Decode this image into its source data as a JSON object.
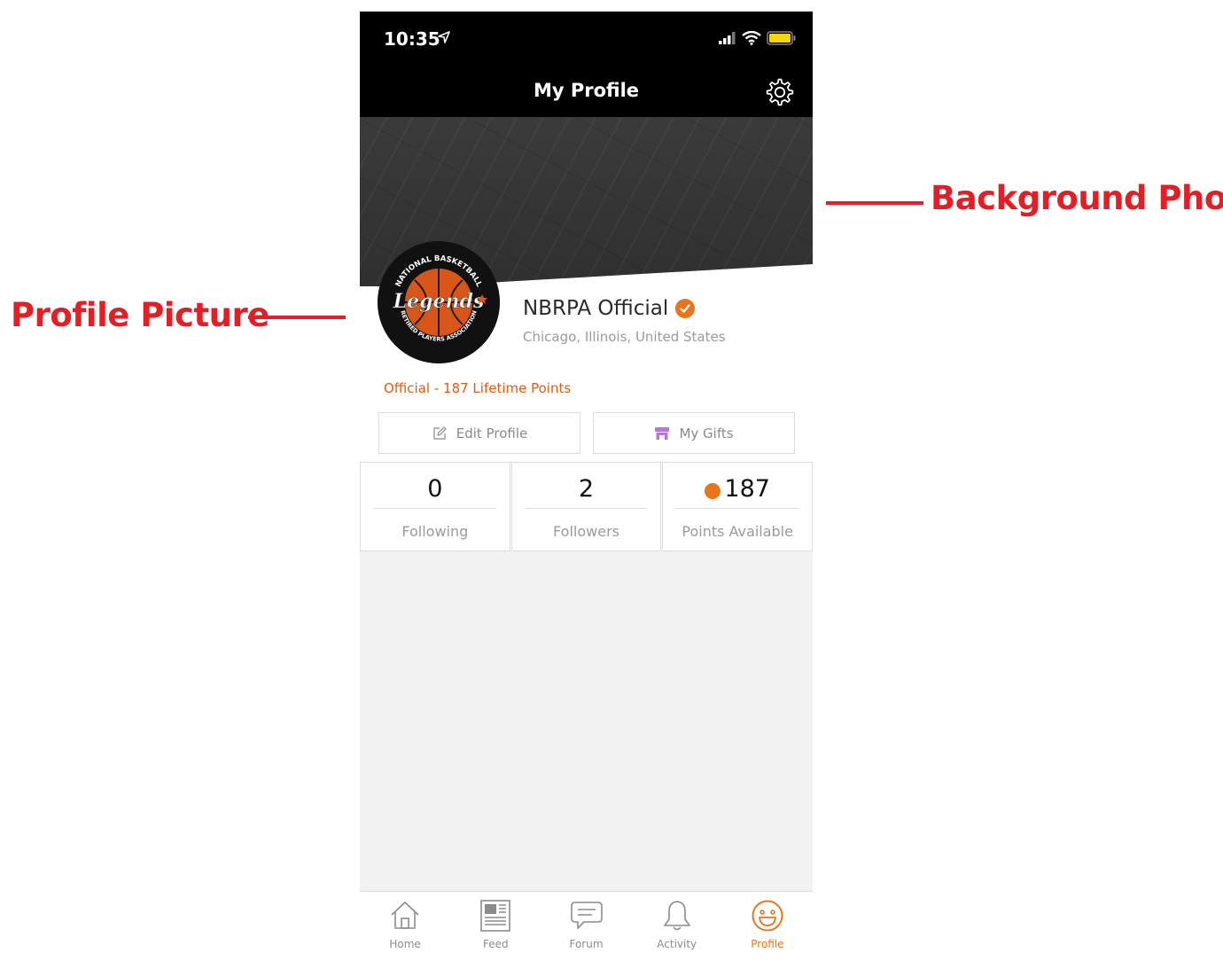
{
  "annotations": {
    "background_photo": "Background Photo",
    "profile_picture": "Profile Picture"
  },
  "status_bar": {
    "time": "10:35"
  },
  "nav": {
    "title": "My Profile"
  },
  "profile": {
    "name": "NBRPA Official",
    "location": "Chicago, Illinois, United States",
    "lifetime": "Official - 187 Lifetime Points",
    "avatar_text_top": "NATIONAL BASKETBALL",
    "avatar_text_main": "Legends",
    "avatar_text_bottom": "RETIRED PLAYERS ASSOCIATION"
  },
  "buttons": {
    "edit_profile": "Edit Profile",
    "my_gifts": "My Gifts"
  },
  "stats": [
    {
      "value": "0",
      "label": "Following"
    },
    {
      "value": "2",
      "label": "Followers"
    },
    {
      "value": "187",
      "label": "Points Available"
    }
  ],
  "tabs": [
    {
      "label": "Home",
      "icon": "home-icon"
    },
    {
      "label": "Feed",
      "icon": "feed-icon"
    },
    {
      "label": "Forum",
      "icon": "forum-icon"
    },
    {
      "label": "Activity",
      "icon": "bell-icon"
    },
    {
      "label": "Profile",
      "icon": "smiley-icon"
    }
  ],
  "colors": {
    "accent": "#e8751a",
    "annotation": "#e31e24"
  }
}
